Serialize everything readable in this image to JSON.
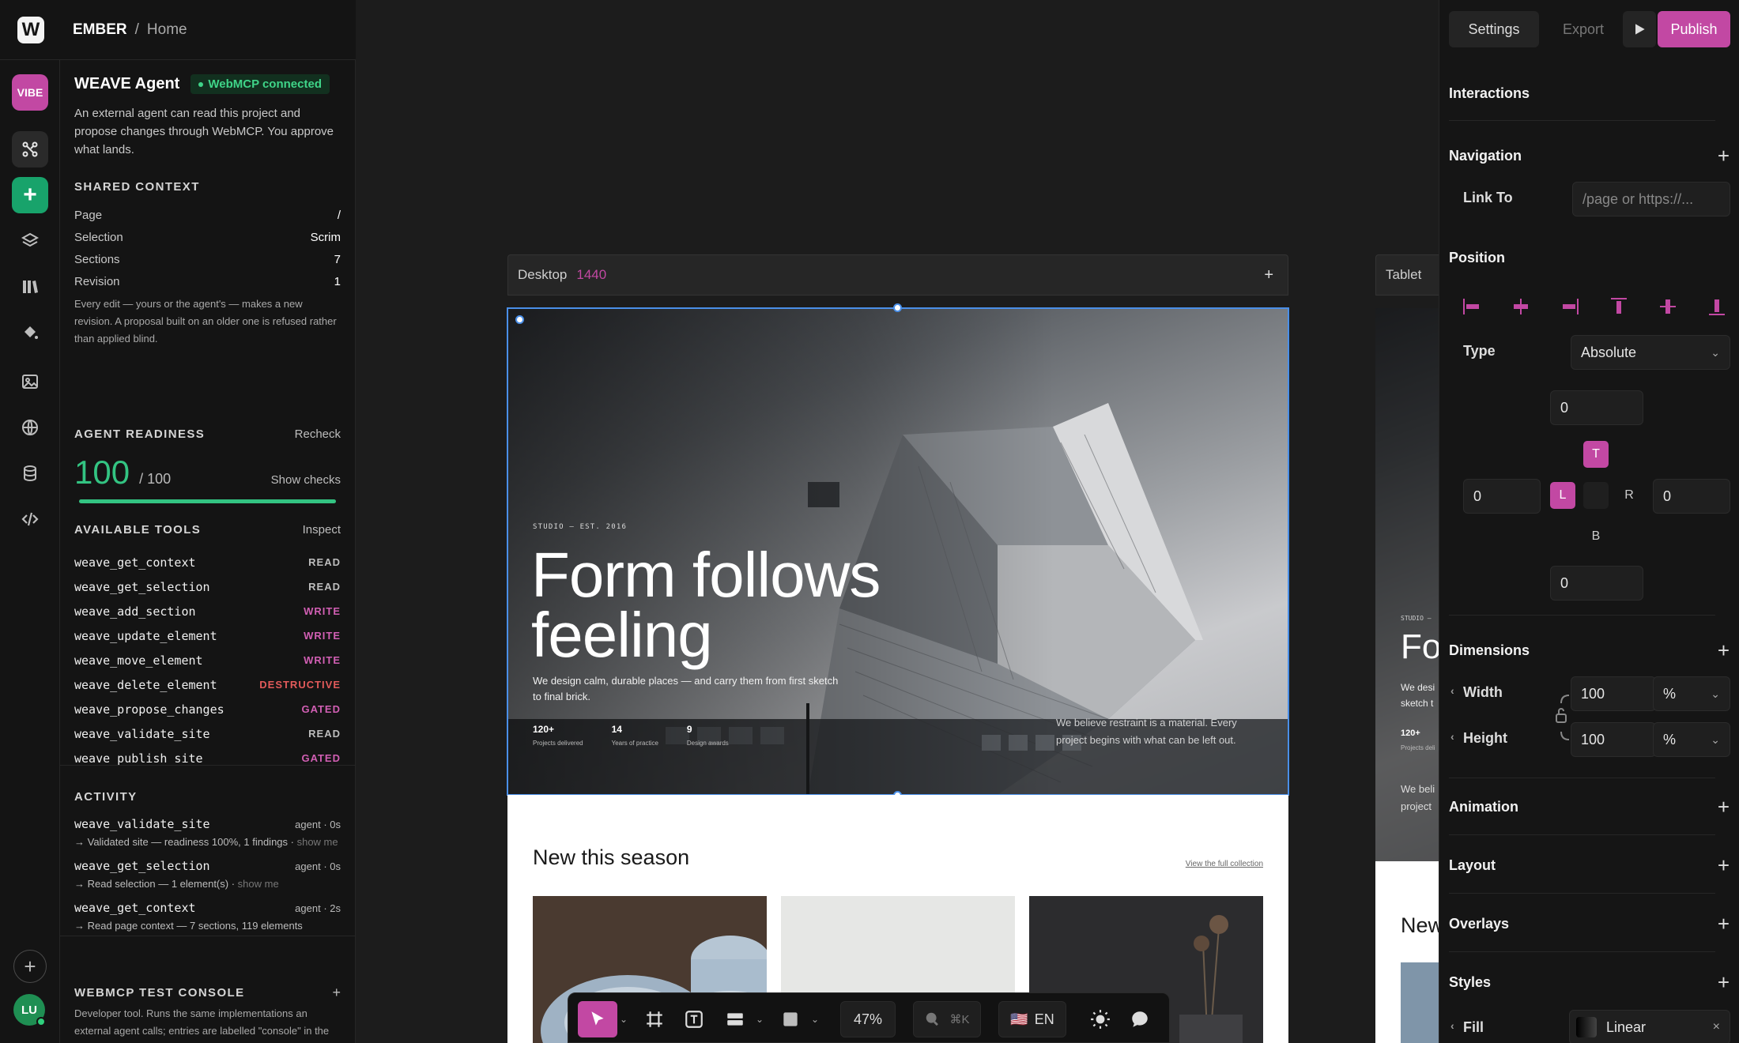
{
  "header": {
    "project": "EMBER",
    "separator": "/",
    "page": "Home"
  },
  "rail": {
    "vibe_label": "VIBE",
    "add_label": "+",
    "avatar_initials": "LU"
  },
  "agent": {
    "title": "WEAVE Agent",
    "status": "WebMCP connected",
    "description": "An external agent can read this project and propose changes through WebMCP. You approve what lands.",
    "shared_context": {
      "heading": "SHARED CONTEXT",
      "rows": [
        {
          "k": "Page",
          "v": "/"
        },
        {
          "k": "Selection",
          "v": "Scrim"
        },
        {
          "k": "Sections",
          "v": "7"
        },
        {
          "k": "Revision",
          "v": "1"
        }
      ],
      "note": "Every edit — yours or the agent's — makes a new revision. A proposal built on an older one is refused rather than applied blind."
    },
    "readiness": {
      "heading": "AGENT READINESS",
      "recheck": "Recheck",
      "score": "100",
      "max": "/ 100",
      "show_checks": "Show checks",
      "fraction": 1.0
    },
    "tools": {
      "heading": "AVAILABLE TOOLS",
      "inspect": "Inspect",
      "items": [
        {
          "name": "weave_get_context",
          "tag": "READ"
        },
        {
          "name": "weave_get_selection",
          "tag": "READ"
        },
        {
          "name": "weave_add_section",
          "tag": "WRITE"
        },
        {
          "name": "weave_update_element",
          "tag": "WRITE"
        },
        {
          "name": "weave_move_element",
          "tag": "WRITE"
        },
        {
          "name": "weave_delete_element",
          "tag": "DESTRUCTIVE"
        },
        {
          "name": "weave_propose_changes",
          "tag": "GATED"
        },
        {
          "name": "weave_validate_site",
          "tag": "READ"
        },
        {
          "name": "weave_publish_site",
          "tag": "GATED"
        }
      ]
    },
    "activity": {
      "heading": "ACTIVITY",
      "items": [
        {
          "name": "weave_validate_site",
          "meta": "agent · 0s",
          "detail": "→ Validated site — readiness 100%, 1 findings ·",
          "more": "show me"
        },
        {
          "name": "weave_get_selection",
          "meta": "agent · 0s",
          "detail": "→ Read selection — 1 element(s) ·",
          "more": "show me"
        },
        {
          "name": "weave_get_context",
          "meta": "agent · 2s",
          "detail": "→ Read page context — 7 sections, 119 elements",
          "more": ""
        }
      ]
    },
    "console": {
      "heading": "WEBMCP TEST CONSOLE",
      "plus": "+",
      "description": "Developer tool. Runs the same implementations an external agent calls; entries are labelled \"console\" in the activity list, never as agent calls."
    }
  },
  "canvas": {
    "desktop": {
      "label": "Desktop",
      "width": "1440",
      "plus": "+"
    },
    "tablet": {
      "label": "Tablet"
    },
    "hero": {
      "eyebrow": "STUDIO — EST. 2016",
      "headline_1": "Form follows",
      "headline_2": "feeling",
      "sub": "We design calm, durable places — and carry them from first sketch to final brick.",
      "stats": [
        {
          "value": "120+",
          "label": "Projects delivered"
        },
        {
          "value": "14",
          "label": "Years of practice"
        },
        {
          "value": "9",
          "label": "Design awards"
        }
      ],
      "quote": "We believe restraint is a material. Every project begins with what can be left out."
    },
    "collection": {
      "title": "New this season",
      "link": "View the full collection"
    },
    "tablet_preview": {
      "eyebrow": "STUDIO —",
      "headline": "Fo",
      "sub_1": "We desi",
      "sub_2": "sketch t",
      "stat": "120+",
      "stat_label": "Projects deli",
      "quote_1": "We beli",
      "quote_2": "project",
      "section_title": "New"
    }
  },
  "toolbar": {
    "zoom": "47%",
    "search_hint": "⌘K",
    "flag": "🇺🇸",
    "lang": "EN"
  },
  "right_panel": {
    "settings": "Settings",
    "export": "Export",
    "publish": "Publish",
    "sections": {
      "interactions": "Interactions",
      "navigation": "Navigation",
      "position": "Position",
      "dimensions": "Dimensions",
      "animation": "Animation",
      "layout": "Layout",
      "overlays": "Overlays",
      "styles": "Styles"
    },
    "link_to": {
      "label": "Link To",
      "placeholder": "/page or https://..."
    },
    "type": {
      "label": "Type",
      "value": "Absolute"
    },
    "offsets": {
      "top": "0",
      "left": "0",
      "right": "0",
      "bottom": "0",
      "t": "T",
      "l": "L",
      "r": "R",
      "b": "B"
    },
    "width": {
      "label": "Width",
      "value": "100",
      "unit": "%"
    },
    "height": {
      "label": "Height",
      "value": "100",
      "unit": "%"
    },
    "fill": {
      "label": "Fill",
      "value": "Linear"
    }
  },
  "colors": {
    "accent": "#c248a3",
    "green": "#33c482",
    "selection": "#4a8fe8"
  }
}
